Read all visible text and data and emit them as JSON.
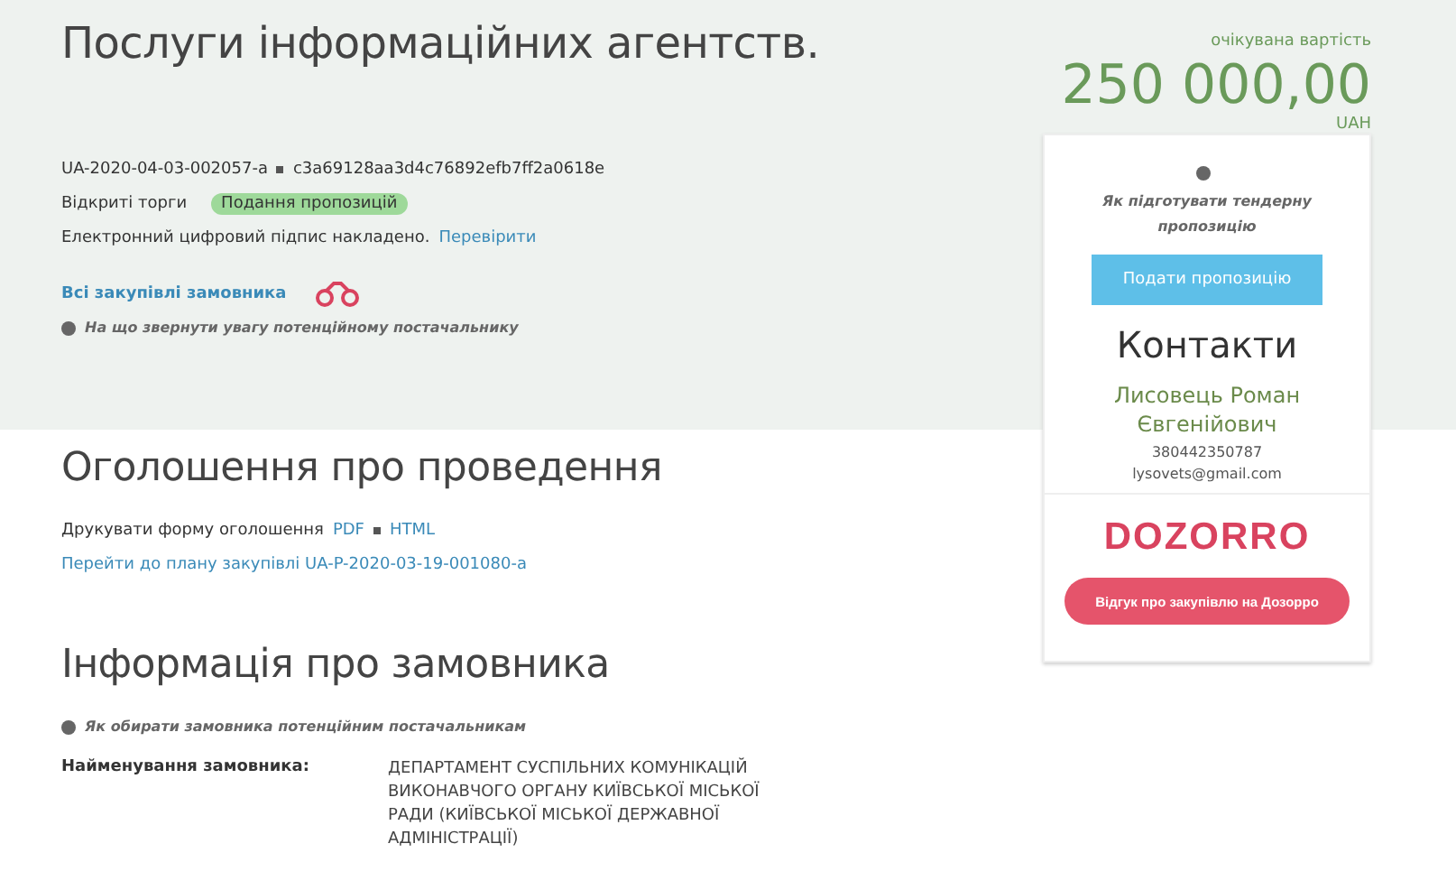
{
  "title": "Послуги інформаційних агентств.",
  "tender": {
    "id": "UA-2020-04-03-002057-a",
    "hash": "c3a69128aa3d4c76892efb7ff2a0618e",
    "procedure": "Відкриті торги",
    "status": "Подання пропозицій",
    "signature_text": "Електронний цифровий підпис накладено.",
    "signature_link": "Перевірити",
    "all_purchases_link": "Всі закупівлі замовника",
    "hint": "На що звернути увагу потенційному постачальнику"
  },
  "price": {
    "label": "очікувана вартість",
    "amount": "250 000,00",
    "currency": "UAH"
  },
  "card": {
    "hint": "Як підготувати тендерну пропозицію",
    "submit_button": "Подати пропозицію",
    "contacts_title": "Контакти",
    "contact_name": "Лисовець Роман Євгенійович",
    "phone": "380442350787",
    "email": "lysovets@gmail.com",
    "logo": "DOZORRO",
    "feedback_button": "Відгук про закупівлю на Дозорро"
  },
  "announcement": {
    "title": "Оголошення про проведення",
    "print_label": "Друкувати форму оголошення",
    "print_links": [
      "PDF",
      "HTML"
    ],
    "plan_link": "Перейти до плану закупівлі UA-P-2020-03-19-001080-a"
  },
  "customer": {
    "title": "Інформація про замовника",
    "hint": "Як обирати замовника потенційним постачальникам",
    "fields": [
      {
        "label": "Найменування замовника:",
        "value": "ДЕПАРТАМЕНТ СУСПІЛЬНИХ КОМУНІКАЦІЙ ВИКОНАВЧОГО ОРГАНУ КИЇВСЬКОЇ МІСЬКОЇ РАДИ (КИЇВСЬКОЇ МІСЬКОЇ ДЕРЖАВНОЇ АДМІНІСТРАЦІЇ)"
      }
    ]
  }
}
